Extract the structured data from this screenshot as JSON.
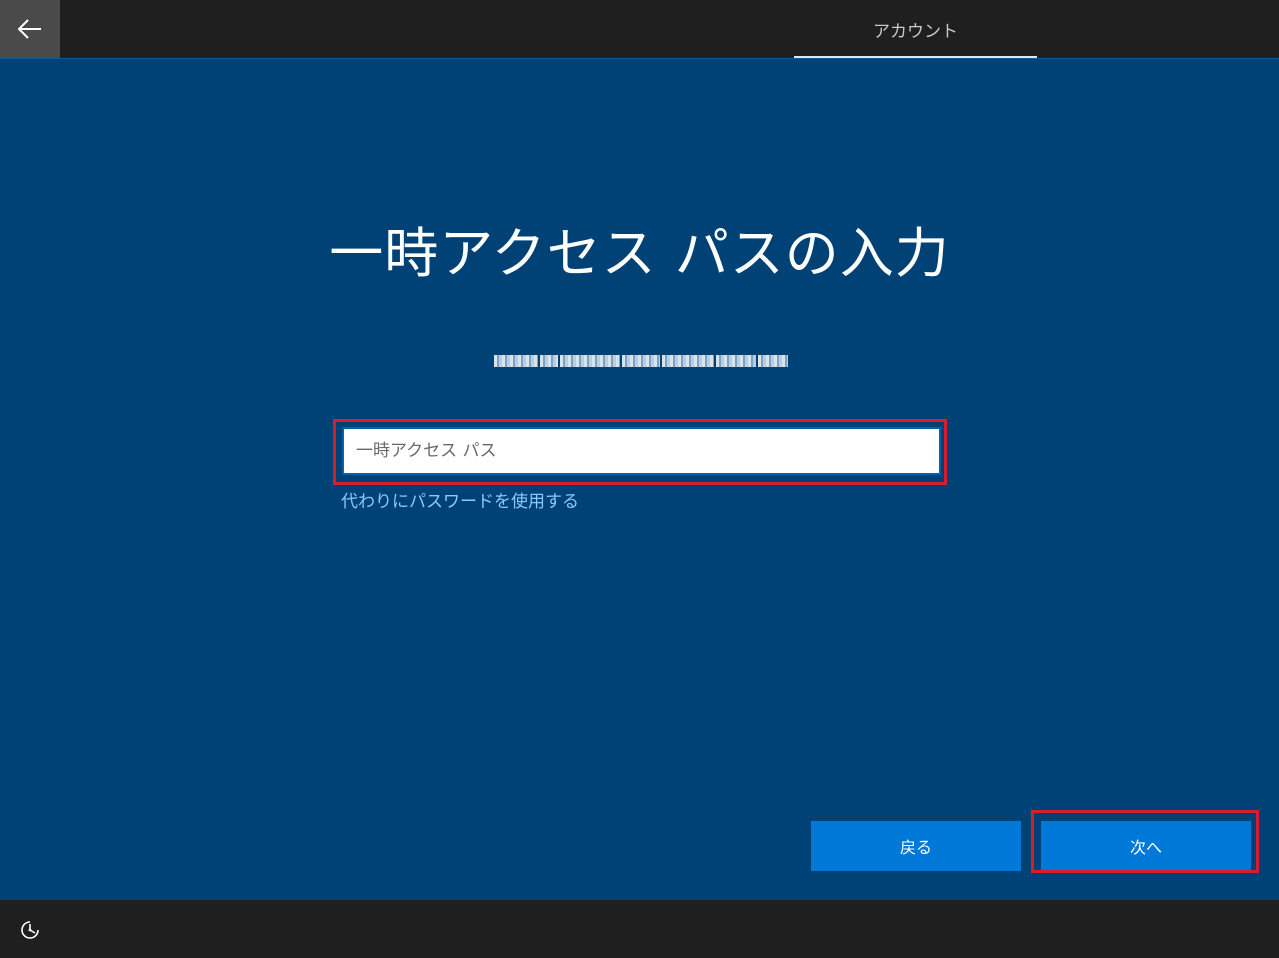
{
  "header": {
    "back_icon": "arrow-left-icon",
    "tab_label": "アカウント"
  },
  "main": {
    "title": "一時アクセス パスの入力",
    "account_email": "NOT-EDITABLE-REDACTED@EXAMPLE",
    "input": {
      "placeholder": "一時アクセス パス",
      "value": ""
    },
    "use_password_link": "代わりにパスワードを使用する"
  },
  "footer": {
    "back_button": "戻る",
    "next_button": "次へ",
    "accessibility_icon": "ease-of-access-icon"
  },
  "colors": {
    "background": "#004275",
    "button": "#0078d7",
    "highlight": "#d81e2c",
    "link": "#8cc8ff"
  }
}
